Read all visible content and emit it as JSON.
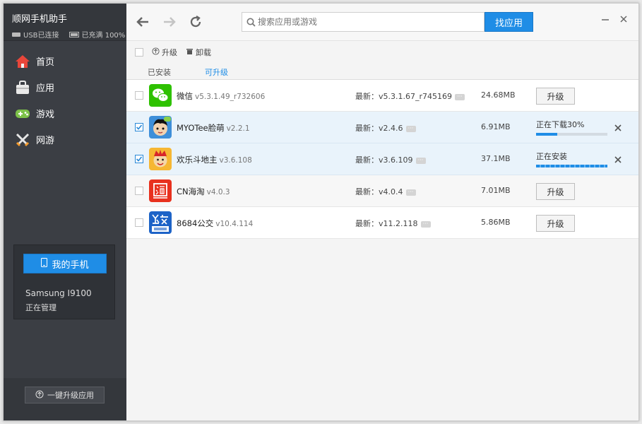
{
  "app": {
    "title": "顺网手机助手",
    "usb_status": "USB已连接",
    "battery_status": "已充满 100%"
  },
  "sidebar": {
    "items": [
      {
        "label": "首页",
        "icon": "home-icon"
      },
      {
        "label": "应用",
        "icon": "apps-bag-icon"
      },
      {
        "label": "游戏",
        "icon": "gamepad-icon"
      },
      {
        "label": "网游",
        "icon": "crossed-swords-icon"
      }
    ],
    "phone": {
      "button_label": "我的手机",
      "model": "Samsung I9100",
      "state": "正在管理"
    },
    "upgrade_all_label": "一键升级应用"
  },
  "topbar": {
    "search_placeholder": "搜索应用或游戏",
    "search_button": "找应用"
  },
  "toolbar": {
    "upgrade_label": "升级",
    "uninstall_label": "卸载"
  },
  "tabs": [
    {
      "label": "已安装",
      "active": false
    },
    {
      "label": "可升级",
      "active": true
    }
  ],
  "list": {
    "latest_prefix": "最新：",
    "upgrade_label": "升级",
    "rows": [
      {
        "name": "微信",
        "version": "v5.3.1.49_r732606",
        "latest": "v5.3.1.67_r745169",
        "size": "24.68MB",
        "checked": false,
        "status": "upgrade"
      },
      {
        "name": "MYOTee脸萌",
        "version": "v2.2.1",
        "latest": "v2.4.6",
        "size": "6.91MB",
        "checked": true,
        "status": "downloading",
        "status_text": "正在下载30%",
        "progress": 0.3
      },
      {
        "name": "欢乐斗地主",
        "version": "v3.6.108",
        "latest": "v3.6.109",
        "size": "37.1MB",
        "checked": true,
        "status": "installing",
        "status_text": "正在安装",
        "progress": 1.0
      },
      {
        "name": "CN海淘",
        "version": "v4.0.3",
        "latest": "v4.0.4",
        "size": "7.01MB",
        "checked": false,
        "status": "upgrade"
      },
      {
        "name": "8684公交",
        "version": "v10.4.114",
        "latest": "v11.2.118",
        "size": "5.86MB",
        "checked": false,
        "status": "upgrade"
      }
    ]
  },
  "colors": {
    "accent": "#1f8de6",
    "sidebar_bg": "#3b3e44",
    "selected_row": "#e9f3fb"
  }
}
